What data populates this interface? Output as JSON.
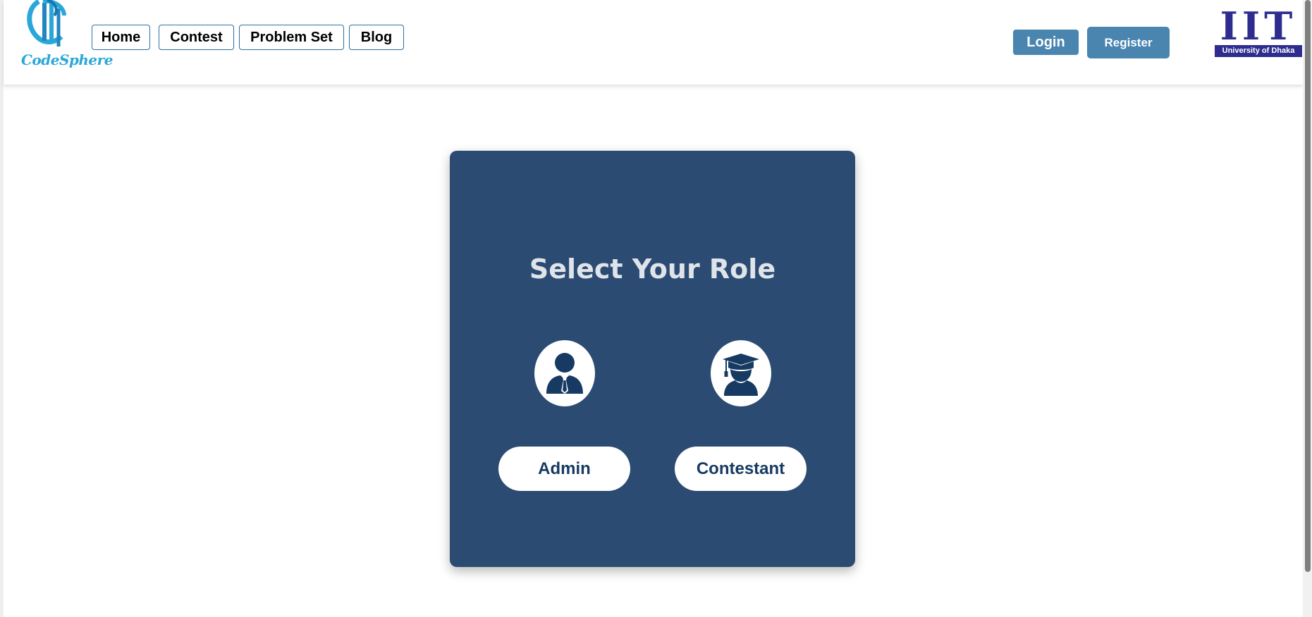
{
  "brand": {
    "name": "CodeSphere",
    "logo_icon": "codesphere-logo-icon"
  },
  "nav": {
    "items": [
      {
        "label": "Home"
      },
      {
        "label": "Contest"
      },
      {
        "label": "Problem Set"
      },
      {
        "label": "Blog"
      }
    ]
  },
  "auth": {
    "login_label": "Login",
    "register_label": "Register"
  },
  "institution": {
    "letters": "IIT",
    "subtitle": "University of Dhaka"
  },
  "role_select": {
    "title": "Select Your Role",
    "roles": [
      {
        "label": "Admin",
        "icon": "admin-person-icon"
      },
      {
        "label": "Contestant",
        "icon": "graduate-person-icon"
      }
    ]
  },
  "colors": {
    "card_bg": "#2c4b72",
    "accent": "#4a85b0",
    "brand": "#2aa7d9",
    "iit": "#2e2d8f",
    "role_text": "#173a63"
  }
}
